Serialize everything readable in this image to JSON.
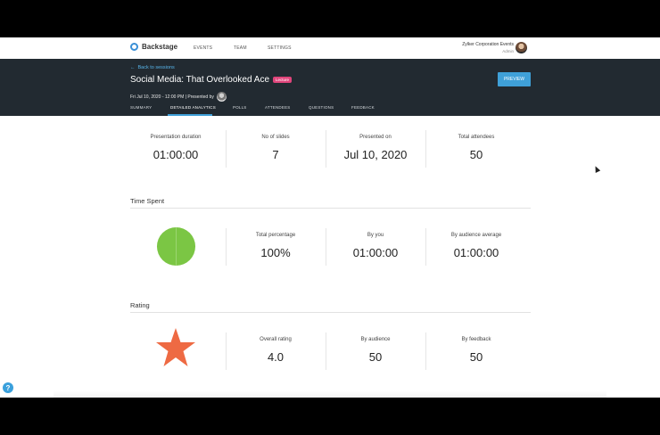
{
  "nav": {
    "brand": "Backstage",
    "links": [
      "EVENTS",
      "TEAM",
      "SETTINGS"
    ],
    "org_name": "Zylker Corporation Events",
    "org_role": "Admin"
  },
  "header": {
    "back_label": "Back to sessions",
    "title": "Social Media: That Overlooked Ace",
    "badge": "Lecture",
    "meta": "Fri Jul 10, 2020 - 12:00 PM | Presented by",
    "preview_label": "PREVIEW",
    "tabs": [
      "SUMMARY",
      "DETAILED ANALYTICS",
      "POLLS",
      "ATTENDEES",
      "QUESTIONS",
      "FEEDBACK"
    ],
    "active_tab": "DETAILED ANALYTICS"
  },
  "overview": [
    {
      "label": "Presentation duration",
      "value": "01:00:00"
    },
    {
      "label": "No of slides",
      "value": "7"
    },
    {
      "label": "Presented on",
      "value": "Jul 10, 2020"
    },
    {
      "label": "Total attendees",
      "value": "50"
    }
  ],
  "time_spent": {
    "title": "Time Spent",
    "stats": [
      {
        "label": "Total percentage",
        "value": "100%"
      },
      {
        "label": "By you",
        "value": "01:00:00"
      },
      {
        "label": "By audience average",
        "value": "01:00:00"
      }
    ],
    "pie_color": "#7bc644",
    "pie_percent": 100
  },
  "rating": {
    "title": "Rating",
    "stats": [
      {
        "label": "Overall rating",
        "value": "4.0"
      },
      {
        "label": "By audience",
        "value": "50"
      },
      {
        "label": "By feedback",
        "value": "50"
      }
    ],
    "star_color": "#ee6a43"
  },
  "colors": {
    "accent": "#3fa0d8",
    "header_bg": "#222a31",
    "badge": "#e0457b"
  },
  "help_icon": "?"
}
